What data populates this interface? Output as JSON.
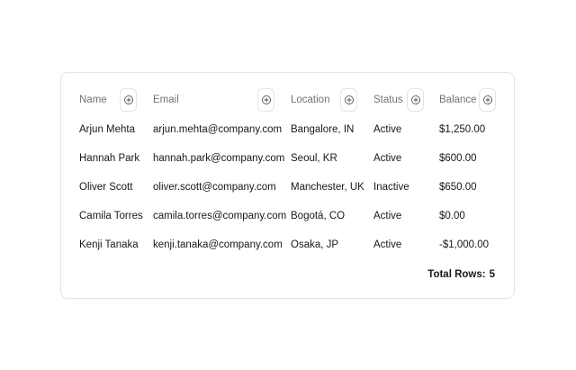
{
  "table": {
    "columns": [
      {
        "key": "name",
        "label": "Name"
      },
      {
        "key": "email",
        "label": "Email"
      },
      {
        "key": "location",
        "label": "Location"
      },
      {
        "key": "status",
        "label": "Status"
      },
      {
        "key": "balance",
        "label": "Balance"
      }
    ],
    "rows": [
      {
        "name": "Arjun Mehta",
        "email": "arjun.mehta@company.com",
        "location": "Bangalore, IN",
        "status": "Active",
        "balance": "$1,250.00"
      },
      {
        "name": "Hannah Park",
        "email": "hannah.park@company.com",
        "location": "Seoul, KR",
        "status": "Active",
        "balance": "$600.00"
      },
      {
        "name": "Oliver Scott",
        "email": "oliver.scott@company.com",
        "location": "Manchester, UK",
        "status": "Inactive",
        "balance": "$650.00"
      },
      {
        "name": "Camila Torres",
        "email": "camila.torres@company.com",
        "location": "Bogotá, CO",
        "status": "Active",
        "balance": "$0.00"
      },
      {
        "name": "Kenji Tanaka",
        "email": "kenji.tanaka@company.com",
        "location": "Osaka, JP",
        "status": "Active",
        "balance": "-$1,000.00"
      }
    ],
    "filter_icon": "plus-circle-dashed-icon",
    "footer": {
      "total_label": "Total Rows:",
      "total_count": "5"
    }
  }
}
